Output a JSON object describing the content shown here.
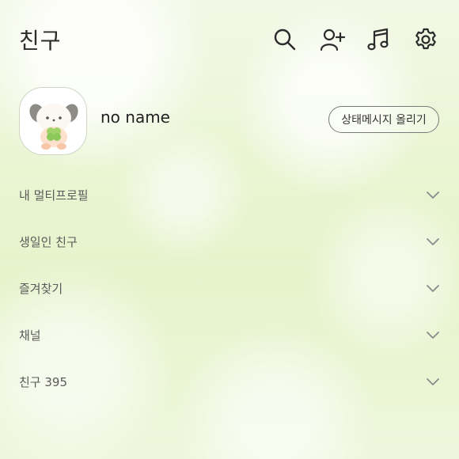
{
  "header": {
    "title": "친구",
    "icons": [
      "search-icon",
      "add-friend-icon",
      "music-icon",
      "settings-icon"
    ]
  },
  "profile": {
    "name": "no name",
    "status_button": "상태메시지 올리기"
  },
  "sections": [
    {
      "label": "내 멀티프로필"
    },
    {
      "label": "생일인 친구"
    },
    {
      "label": "즐겨찾기"
    },
    {
      "label": "채널"
    },
    {
      "label": "친구 395"
    }
  ],
  "colors": {
    "background": "#e9f5cf",
    "text": "#2b2b2b",
    "section_text": "#5a5a5a",
    "icon": "#2b2b2b"
  }
}
